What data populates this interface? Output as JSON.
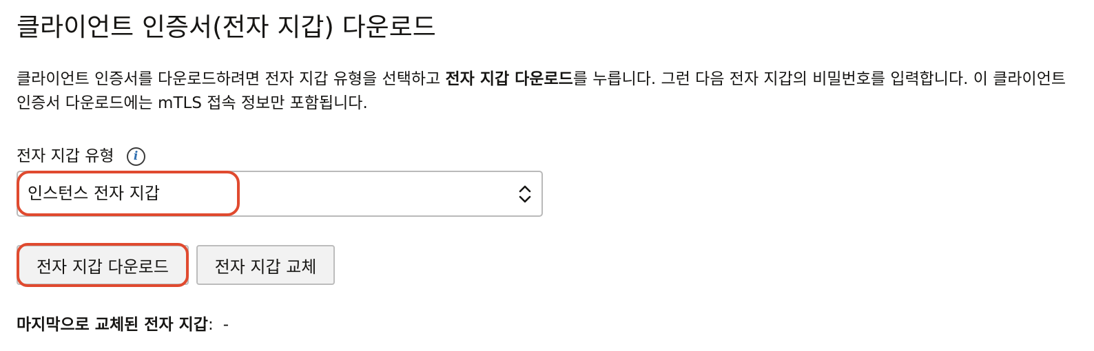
{
  "page": {
    "title": "클라이언트 인증서(전자 지갑) 다운로드"
  },
  "description": {
    "part1": "클라이언트 인증서를 다운로드하려면 전자 지갑 유형을 선택하고 ",
    "bold": "전자 지갑 다운로드",
    "part2": "를 누릅니다. 그런 다음 전자 지갑의 비밀번호를 입력합니다. 이 클라이언트 인증서 다운로드에는 mTLS 접속 정보만 포함됩니다."
  },
  "wallet_type": {
    "label": "전자 지갑 유형",
    "info_icon": "info-icon",
    "selected": "인스턴스 전자 지갑"
  },
  "buttons": {
    "download": "전자 지갑 다운로드",
    "rotate": "전자 지갑 교체"
  },
  "last_rotated": {
    "label": "마지막으로 교체된 전자 지갑",
    "colon": ":",
    "value": "-"
  },
  "colors": {
    "highlight": "#e04a2f",
    "info_glyph": "#2f6fb0",
    "button_bg": "#f2f2f2",
    "border": "#b9b9b9"
  }
}
